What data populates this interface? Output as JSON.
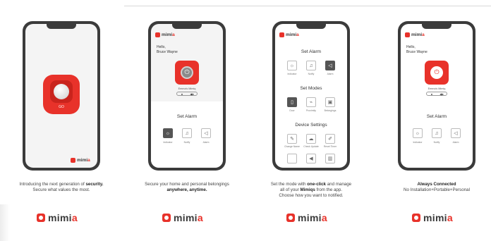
{
  "brand": {
    "name_main": "mimi",
    "name_accent": "a"
  },
  "panels": {
    "p1": {
      "device_label": "GO",
      "caption_line1_pre": "Introducing the next generation of ",
      "caption_line1_bold": "security.",
      "caption_line2": "Secure what values the most."
    },
    "p2": {
      "greeting": "Hello,",
      "user": "Bruce Wayne",
      "mode_label": "Emma's Mimiq",
      "section": "Set Alarm",
      "alarm_items": [
        "Indicator",
        "Notify",
        "Alarm"
      ],
      "caption_line1": "Secure your home and personal belongings",
      "caption_line2_bold": "anywhere, anytime."
    },
    "p3": {
      "section1": "Set Alarm",
      "alarm_items": [
        "Indicator",
        "Notify",
        "Alarm"
      ],
      "section2": "Set Modes",
      "mode_items": [
        "Door",
        "Proximity",
        "Belongings"
      ],
      "section3": "Device Settings",
      "setting_items": [
        "Change Name",
        "Check Update",
        "Reset Timer"
      ],
      "caption_line1_pre": "Set the mode with ",
      "caption_line1_bold": "one-click",
      "caption_line1_post": " and manage",
      "caption_line2_pre": "all of your ",
      "caption_line2_bold": "Mimiqs",
      "caption_line2_post": " from the app.",
      "caption_line3": "Choose how you want to notified."
    },
    "p4": {
      "greeting": "Hello,",
      "user": "Bruce Wayne",
      "mode_label": "Emma's Mimiq",
      "section": "Set Alarm",
      "alarm_items": [
        "Indicator",
        "Notify",
        "Alarm"
      ],
      "caption_line1_bold": "Always Connected",
      "caption_line2": "No Installation+Portable+Personal"
    }
  },
  "colors": {
    "accent": "#e8322a",
    "phone": "#3b3b3b",
    "screen": "#f4f4f4"
  }
}
